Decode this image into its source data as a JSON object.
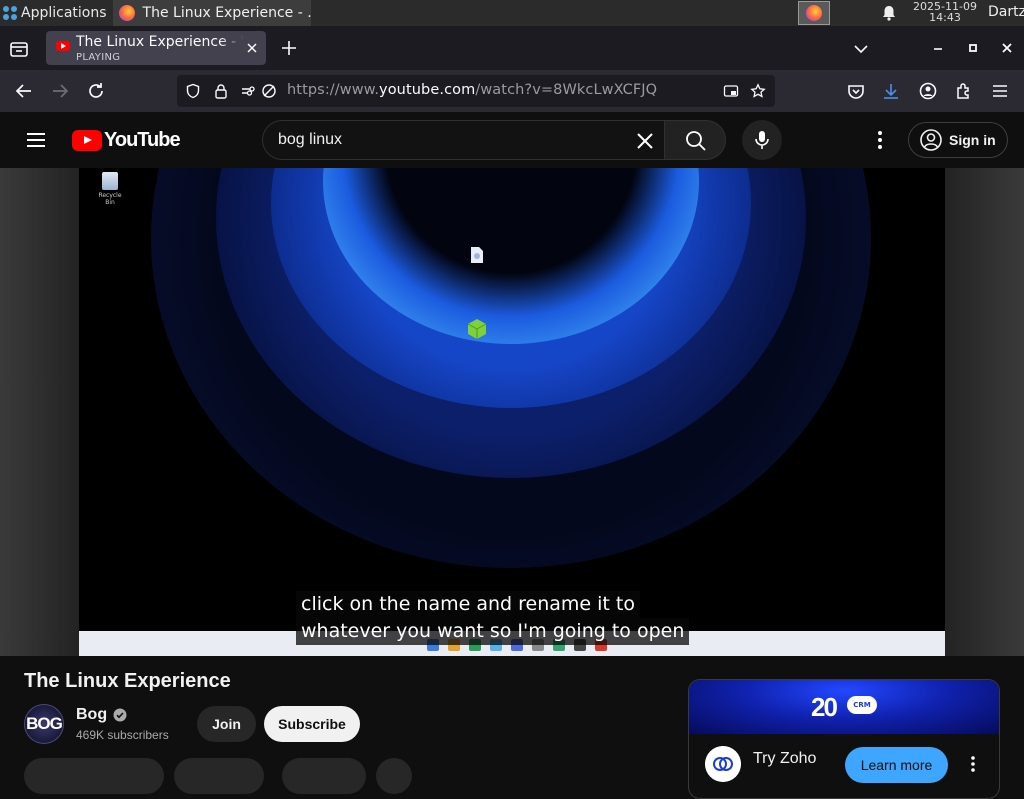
{
  "taskbar": {
    "apps_label": "Applications",
    "window_title": "The Linux Experience - ...",
    "clock_date": "2025-11-09",
    "clock_time": "14:43",
    "user": "Dartz"
  },
  "browser": {
    "tab_title": "The Linux Experience - YouTube",
    "tab_status": "PLAYING",
    "url_prefix": "https://www.",
    "url_domain": "youtube.com",
    "url_path": "/watch?v=8WkcLwXCFJQ"
  },
  "youtube": {
    "logo_text": "YouTube",
    "search_query": "bog linux",
    "sign_in_label": "Sign in"
  },
  "video": {
    "caption_line1": "click on the name and rename it to",
    "caption_line2": "whatever you want so I'm going to open",
    "title": "The Linux Experience",
    "channel_initials": "BOG",
    "channel_name": "Bog",
    "subscribers": "469K subscribers",
    "join_label": "Join",
    "subscribe_label": "Subscribe"
  },
  "ad": {
    "banner_number": "20",
    "banner_badge": "CRM",
    "title": "Try Zoho",
    "cta_label": "Learn more"
  },
  "colors": {
    "yt_red": "#ff0000",
    "cta_blue": "#3ea6ff",
    "browser_tab_bg": "#42414d"
  }
}
